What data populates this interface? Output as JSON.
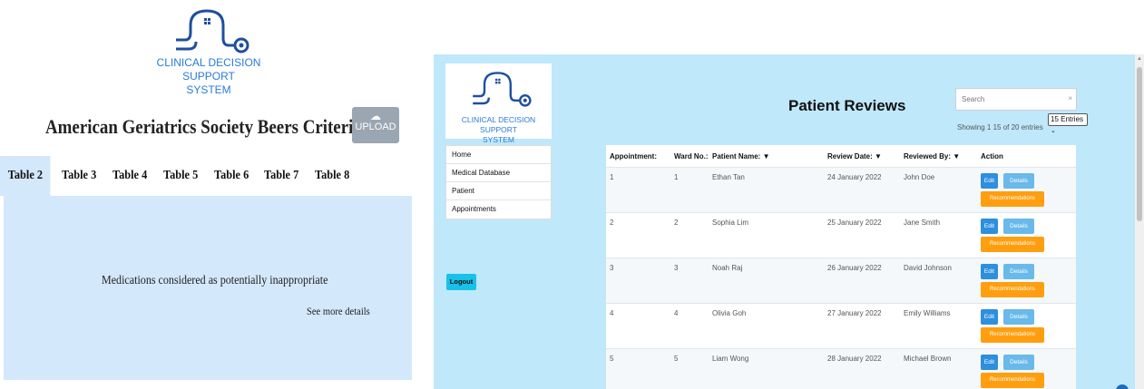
{
  "logo": {
    "line1": "CLINICAL DECISION SUPPORT",
    "line2": "SYSTEM",
    "brand_color": "#2a7bd8"
  },
  "left_panel": {
    "title": "American Geriatrics Society Beers Criteria",
    "upload_label": "UPLOAD",
    "upload_icon": "cloud-upload-icon",
    "tabs": [
      {
        "label": "Table 2",
        "active": true
      },
      {
        "label": "Table 3",
        "active": false
      },
      {
        "label": "Table 4",
        "active": false
      },
      {
        "label": "Table 5",
        "active": false
      },
      {
        "label": "Table 6",
        "active": false
      },
      {
        "label": "Table 7",
        "active": false
      },
      {
        "label": "Table 8",
        "active": false
      }
    ],
    "content": {
      "description": "Medications considered as potentially inappropriate",
      "more_link": "See more details"
    }
  },
  "right_panel": {
    "page_title": "Patient Reviews",
    "search": {
      "placeholder": "Search",
      "clear_icon": "close-icon"
    },
    "showing_text": "Showing 1 15 of 20 entries",
    "entries_select": "15 Entries",
    "nav": [
      {
        "label": "Home"
      },
      {
        "label": "Medical Database"
      },
      {
        "label": "Patient"
      },
      {
        "label": "Appointments"
      }
    ],
    "logout_label": "Logout",
    "table": {
      "headers": [
        "Appointment:",
        "Ward No.:",
        "Patient Name: ▼",
        "Review Date: ▼",
        "Reviewed By: ▼",
        "Action"
      ],
      "rows": [
        {
          "appointment": "1",
          "ward": "1",
          "patient": "Ethan Tan",
          "date": "24 January 2022",
          "reviewer": "John Doe"
        },
        {
          "appointment": "2",
          "ward": "2",
          "patient": "Sophia Lim",
          "date": "25 January 2022",
          "reviewer": "Jane Smith"
        },
        {
          "appointment": "3",
          "ward": "3",
          "patient": "Noah Raj",
          "date": "26 January 2022",
          "reviewer": "David Johnson"
        },
        {
          "appointment": "4",
          "ward": "4",
          "patient": "Olivia Goh",
          "date": "27 January 2022",
          "reviewer": "Emily Williams"
        },
        {
          "appointment": "5",
          "ward": "5",
          "patient": "Liam Wong",
          "date": "28 January 2022",
          "reviewer": "Michael Brown"
        }
      ],
      "actions": {
        "edit": "Edit",
        "details": "Details",
        "recommendations": "Recommendations"
      }
    },
    "colors": {
      "background": "#bfe8fb",
      "edit": "#2d8fde",
      "details": "#69b9ea",
      "recommendations": "#ff9f0f",
      "logout": "#17c1e8"
    }
  }
}
